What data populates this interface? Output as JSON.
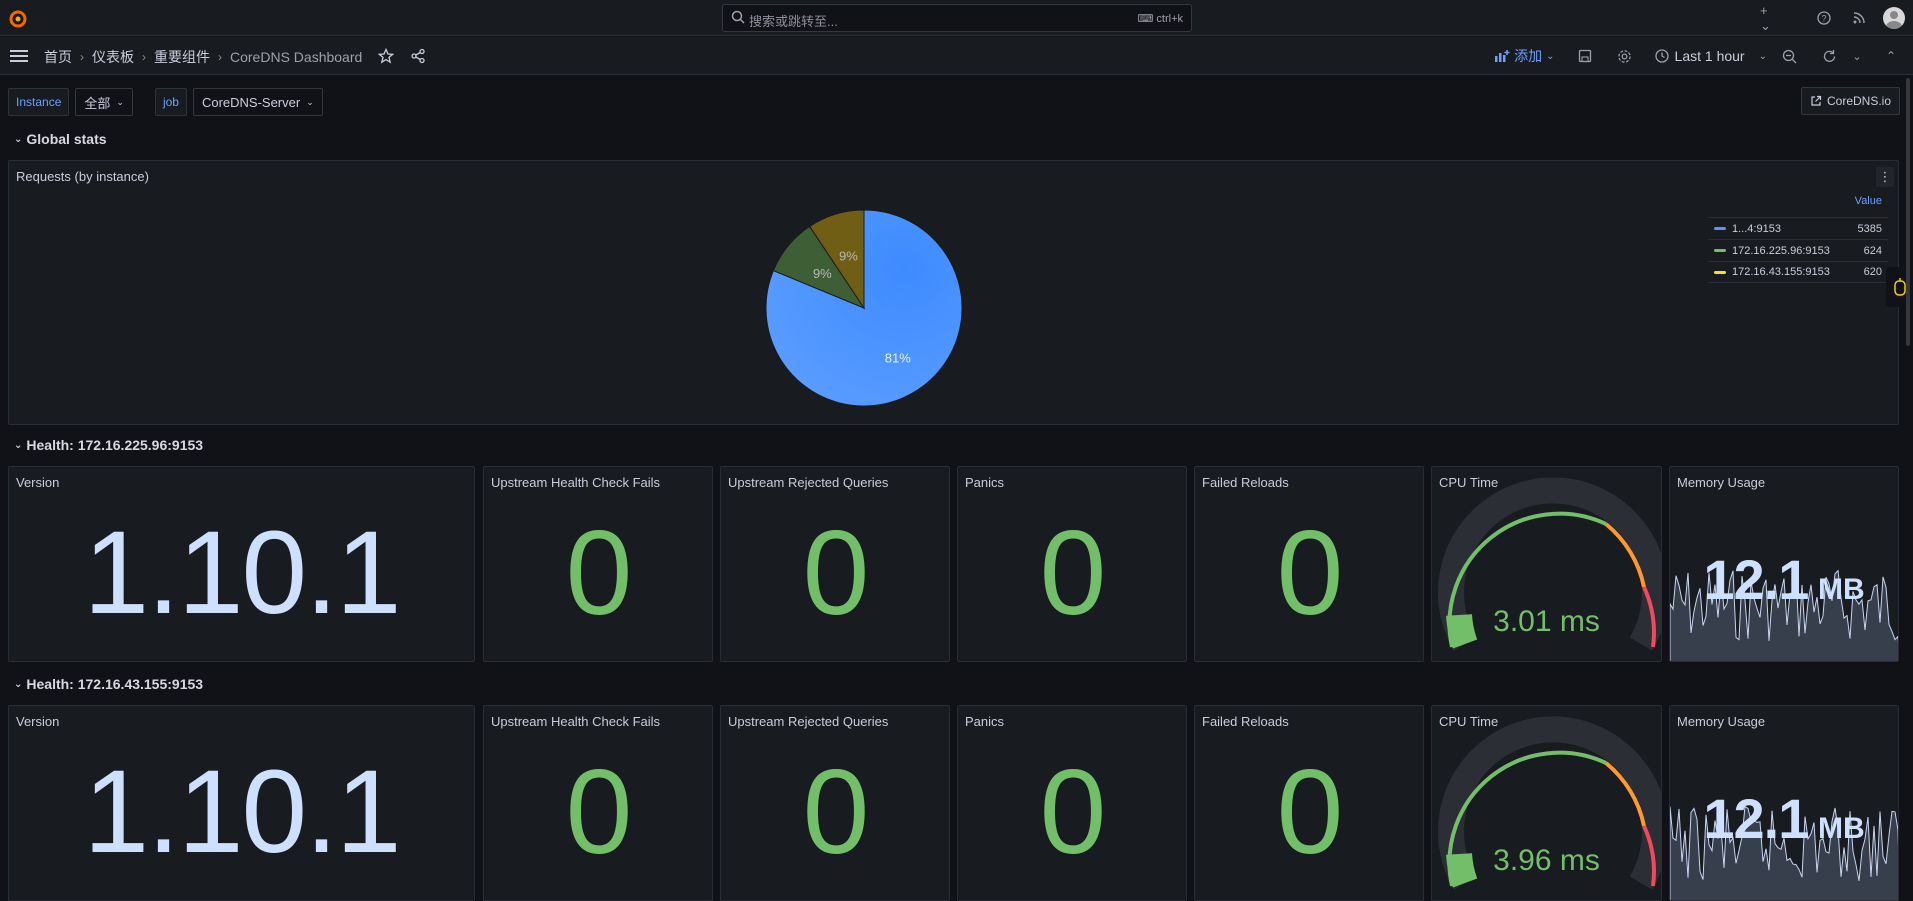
{
  "topbar": {
    "search_placeholder": "搜索或跳转至...",
    "search_shortcut": "ctrl+k",
    "icons": [
      "grafana-logo-icon",
      "plus-icon",
      "help-icon",
      "news-icon",
      "avatar"
    ]
  },
  "navbar": {
    "breadcrumbs": [
      "首页",
      "仪表板",
      "重要组件",
      "CoreDNS Dashboard"
    ],
    "add_label": "添加",
    "time_range": "Last 1 hour"
  },
  "variables": {
    "instance_label": "Instance",
    "instance_value": "全部",
    "job_label": "job",
    "job_value": "CoreDNS-Server"
  },
  "link_button": "CoreDNS.io",
  "rows": {
    "global": "Global stats",
    "health1": "Health: 172.16.225.96:9153",
    "health2": "Health: 172.16.43.155:9153"
  },
  "pie_panel": {
    "title": "Requests (by instance)",
    "legend_header": "Value",
    "legend": [
      {
        "name": "1...4:9153",
        "value": "5385",
        "color": "#5794f2"
      },
      {
        "name": "172.16.225.96:9153",
        "value": "624",
        "color": "#73bf69"
      },
      {
        "name": "172.16.43.155:9153",
        "value": "620",
        "color": "#fade2a"
      }
    ]
  },
  "chart_data": {
    "type": "pie",
    "title": "Requests (by instance)",
    "slices": [
      {
        "label": "1...4:9153",
        "value": 5385,
        "percent_label": "81%",
        "color": "#3274d9"
      },
      {
        "label": "172.16.225.96:9153",
        "value": 624,
        "percent_label": "9%",
        "color": "#37872d"
      },
      {
        "label": "172.16.43.155:9153",
        "value": 620,
        "percent_label": "9%",
        "color": "#8f7b00"
      }
    ]
  },
  "health_panels": [
    {
      "version_title": "Version",
      "version": "1.10.1",
      "stats": [
        {
          "title": "Upstream Health Check Fails",
          "value": "0"
        },
        {
          "title": "Upstream Rejected Queries",
          "value": "0"
        },
        {
          "title": "Panics",
          "value": "0"
        },
        {
          "title": "Failed Reloads",
          "value": "0"
        }
      ],
      "cpu_title": "CPU Time",
      "cpu_value": "3.01 ms",
      "mem_title": "Memory Usage",
      "mem_value": "12.1",
      "mem_unit": "MB"
    },
    {
      "version_title": "Version",
      "version": "1.10.1",
      "stats": [
        {
          "title": "Upstream Health Check Fails",
          "value": "0"
        },
        {
          "title": "Upstream Rejected Queries",
          "value": "0"
        },
        {
          "title": "Panics",
          "value": "0"
        },
        {
          "title": "Failed Reloads",
          "value": "0"
        }
      ],
      "cpu_title": "CPU Time",
      "cpu_value": "3.96 ms",
      "mem_title": "Memory Usage",
      "mem_value": "12.1",
      "mem_unit": "MB"
    }
  ],
  "colors": {
    "green": "#73bf69",
    "blue_text": "#cde0ff",
    "accent": "#6e9fff"
  }
}
